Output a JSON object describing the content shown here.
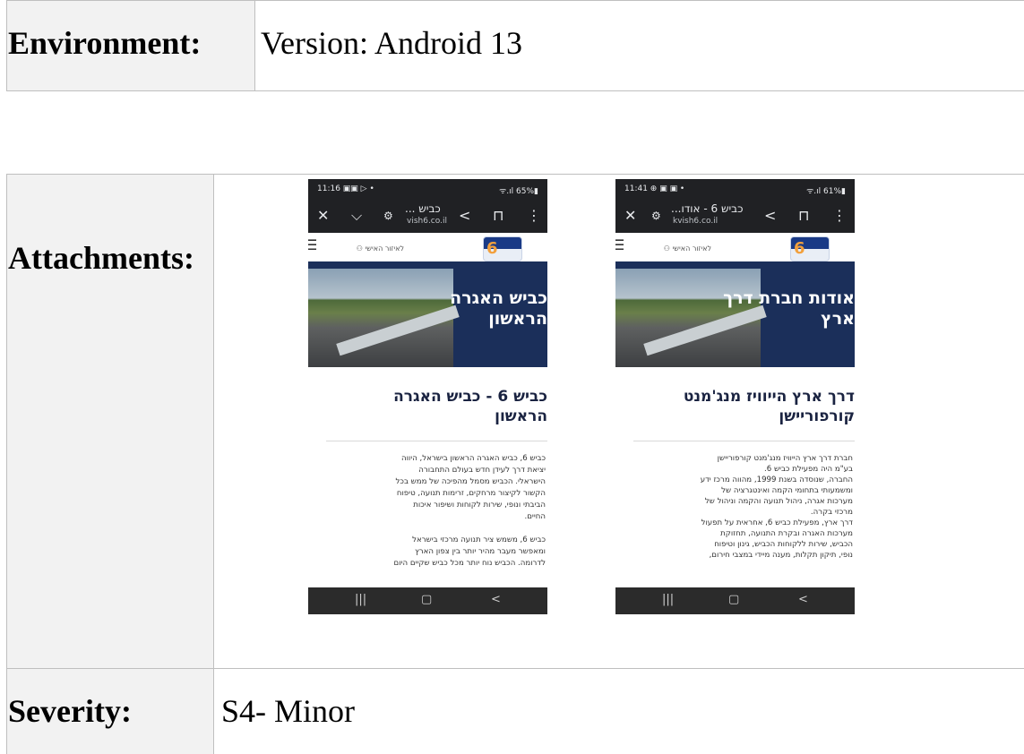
{
  "environment": {
    "label": "Environment:",
    "value": "Version: Android 13"
  },
  "attachments": {
    "label": "Attachments:",
    "screenshots": [
      {
        "status_time": "11:16 ▣▣ ▷ •",
        "status_right": "ᯤ.ıl 65%▮",
        "toolbar_title": "כביש ...",
        "toolbar_url": "vish6.co.il",
        "account_label": "לאיזור האישי",
        "hero_title": "כביש האגרה\nהראשון",
        "heading": "כביש 6 - כביש האגרה\nהראשון",
        "body": "כביש 6, כביש האגרה הראשון בישראל, היווה\nיציאת דרך לעידן חדש בעולם התחבורה\nהישראלי. הכביש מסמל מהפיכה של ממש בכל\nהקשור לקיצור מרחקים, זרימות תנועה, טיפוח\nהביבתי ונופי, שירות לקוחות ושיפור איכות\nהחיים.\n\nכביש 6, משמש ציר תנועה מרכזי בישראל\nומאפשר מעבר מהיר יותר בין צפון הארץ\nלדרומה. הכביש נוח יותר מכל כביש שקיים היום"
      },
      {
        "status_time": "11:41 ⊕ ▣ ▣ •",
        "status_right": "ᯤ.ıl 61%▮",
        "toolbar_title": "כביש 6 - אודו...",
        "toolbar_url": "kvish6.co.il",
        "account_label": "לאיזור האישי",
        "hero_title": "אודות חברת דרך\nארץ",
        "heading": "דרך ארץ הייוויז מנג'מנט\nקורפוריישן",
        "body": "חברת דרך ארץ הייוויז מנג'מנט קורפוריישן\nבע\"מ היה מפעילת כביש 6.\nהחברה, שנוסדה בשנת 1999, מהווה מרכז ידע\nומשמעותי בתחומי הקמה ואינטגרציה של\nמערכות אגרה, ניהול תנועה והקמה וניהול של\nמרכזי בקרה.\nדרך ארץ, מפעילת כביש 6, אחראית על תפעול\nמערכות האגרה ובקרת התנועה, תחזוקת\nהכביש, שירות ללקוחות הכביש, גינון וטיפוח\nנופי, תיקון תקלות, מענה מיידי במצבי חירום,"
      }
    ]
  },
  "severity": {
    "label": "Severity:",
    "value": "S4- Minor"
  }
}
